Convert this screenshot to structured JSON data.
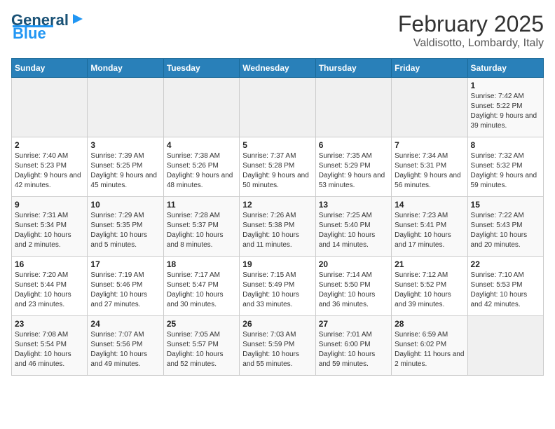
{
  "header": {
    "logo_general": "General",
    "logo_blue": "Blue",
    "title": "February 2025",
    "subtitle": "Valdisotto, Lombardy, Italy"
  },
  "calendar": {
    "days_of_week": [
      "Sunday",
      "Monday",
      "Tuesday",
      "Wednesday",
      "Thursday",
      "Friday",
      "Saturday"
    ],
    "weeks": [
      [
        {
          "day": "",
          "info": ""
        },
        {
          "day": "",
          "info": ""
        },
        {
          "day": "",
          "info": ""
        },
        {
          "day": "",
          "info": ""
        },
        {
          "day": "",
          "info": ""
        },
        {
          "day": "",
          "info": ""
        },
        {
          "day": "1",
          "info": "Sunrise: 7:42 AM\nSunset: 5:22 PM\nDaylight: 9 hours and 39 minutes."
        }
      ],
      [
        {
          "day": "2",
          "info": "Sunrise: 7:40 AM\nSunset: 5:23 PM\nDaylight: 9 hours and 42 minutes."
        },
        {
          "day": "3",
          "info": "Sunrise: 7:39 AM\nSunset: 5:25 PM\nDaylight: 9 hours and 45 minutes."
        },
        {
          "day": "4",
          "info": "Sunrise: 7:38 AM\nSunset: 5:26 PM\nDaylight: 9 hours and 48 minutes."
        },
        {
          "day": "5",
          "info": "Sunrise: 7:37 AM\nSunset: 5:28 PM\nDaylight: 9 hours and 50 minutes."
        },
        {
          "day": "6",
          "info": "Sunrise: 7:35 AM\nSunset: 5:29 PM\nDaylight: 9 hours and 53 minutes."
        },
        {
          "day": "7",
          "info": "Sunrise: 7:34 AM\nSunset: 5:31 PM\nDaylight: 9 hours and 56 minutes."
        },
        {
          "day": "8",
          "info": "Sunrise: 7:32 AM\nSunset: 5:32 PM\nDaylight: 9 hours and 59 minutes."
        }
      ],
      [
        {
          "day": "9",
          "info": "Sunrise: 7:31 AM\nSunset: 5:34 PM\nDaylight: 10 hours and 2 minutes."
        },
        {
          "day": "10",
          "info": "Sunrise: 7:29 AM\nSunset: 5:35 PM\nDaylight: 10 hours and 5 minutes."
        },
        {
          "day": "11",
          "info": "Sunrise: 7:28 AM\nSunset: 5:37 PM\nDaylight: 10 hours and 8 minutes."
        },
        {
          "day": "12",
          "info": "Sunrise: 7:26 AM\nSunset: 5:38 PM\nDaylight: 10 hours and 11 minutes."
        },
        {
          "day": "13",
          "info": "Sunrise: 7:25 AM\nSunset: 5:40 PM\nDaylight: 10 hours and 14 minutes."
        },
        {
          "day": "14",
          "info": "Sunrise: 7:23 AM\nSunset: 5:41 PM\nDaylight: 10 hours and 17 minutes."
        },
        {
          "day": "15",
          "info": "Sunrise: 7:22 AM\nSunset: 5:43 PM\nDaylight: 10 hours and 20 minutes."
        }
      ],
      [
        {
          "day": "16",
          "info": "Sunrise: 7:20 AM\nSunset: 5:44 PM\nDaylight: 10 hours and 23 minutes."
        },
        {
          "day": "17",
          "info": "Sunrise: 7:19 AM\nSunset: 5:46 PM\nDaylight: 10 hours and 27 minutes."
        },
        {
          "day": "18",
          "info": "Sunrise: 7:17 AM\nSunset: 5:47 PM\nDaylight: 10 hours and 30 minutes."
        },
        {
          "day": "19",
          "info": "Sunrise: 7:15 AM\nSunset: 5:49 PM\nDaylight: 10 hours and 33 minutes."
        },
        {
          "day": "20",
          "info": "Sunrise: 7:14 AM\nSunset: 5:50 PM\nDaylight: 10 hours and 36 minutes."
        },
        {
          "day": "21",
          "info": "Sunrise: 7:12 AM\nSunset: 5:52 PM\nDaylight: 10 hours and 39 minutes."
        },
        {
          "day": "22",
          "info": "Sunrise: 7:10 AM\nSunset: 5:53 PM\nDaylight: 10 hours and 42 minutes."
        }
      ],
      [
        {
          "day": "23",
          "info": "Sunrise: 7:08 AM\nSunset: 5:54 PM\nDaylight: 10 hours and 46 minutes."
        },
        {
          "day": "24",
          "info": "Sunrise: 7:07 AM\nSunset: 5:56 PM\nDaylight: 10 hours and 49 minutes."
        },
        {
          "day": "25",
          "info": "Sunrise: 7:05 AM\nSunset: 5:57 PM\nDaylight: 10 hours and 52 minutes."
        },
        {
          "day": "26",
          "info": "Sunrise: 7:03 AM\nSunset: 5:59 PM\nDaylight: 10 hours and 55 minutes."
        },
        {
          "day": "27",
          "info": "Sunrise: 7:01 AM\nSunset: 6:00 PM\nDaylight: 10 hours and 59 minutes."
        },
        {
          "day": "28",
          "info": "Sunrise: 6:59 AM\nSunset: 6:02 PM\nDaylight: 11 hours and 2 minutes."
        },
        {
          "day": "",
          "info": ""
        }
      ]
    ]
  }
}
